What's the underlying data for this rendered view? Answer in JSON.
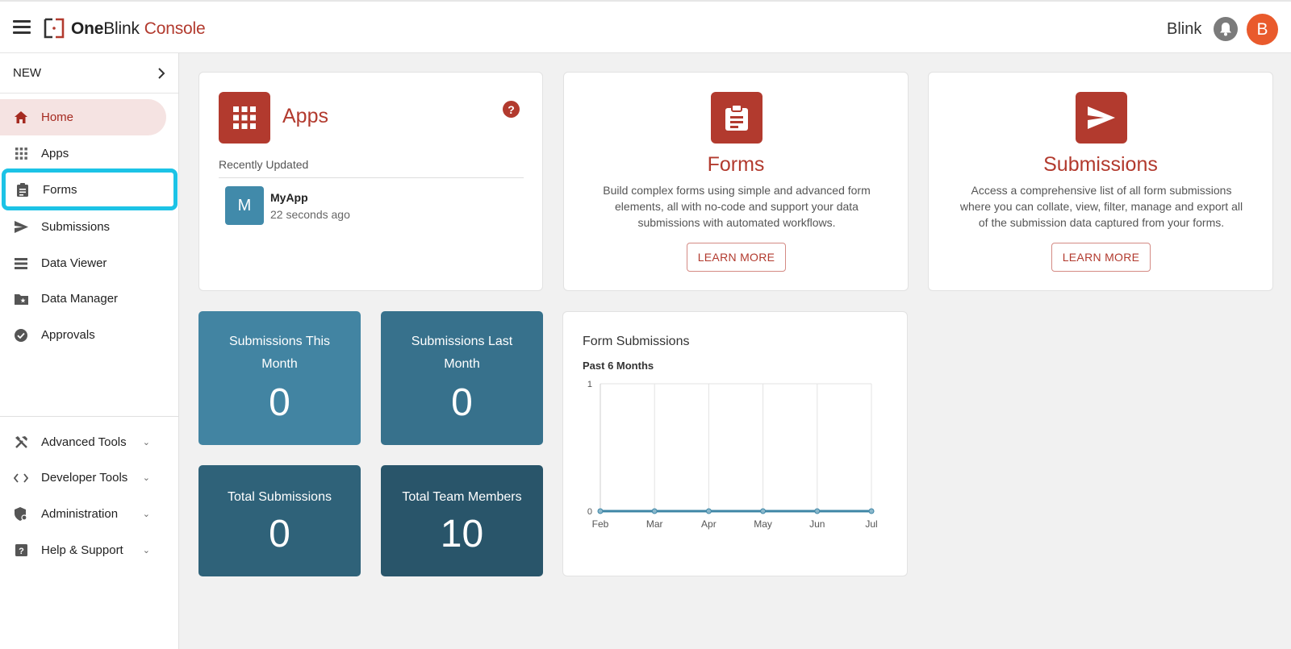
{
  "header": {
    "brand_bold": "One",
    "brand_regular": "Blink",
    "brand_accent": "Console",
    "user_name": "Blink",
    "avatar_initial": "B",
    "icons": [
      "menu-icon",
      "onblink-logo",
      "bell-icon"
    ]
  },
  "sidebar": {
    "new_label": "NEW",
    "items": [
      {
        "label": "Home",
        "icon": "home-icon"
      },
      {
        "label": "Apps",
        "icon": "grid-icon"
      },
      {
        "label": "Forms",
        "icon": "clipboard-icon"
      },
      {
        "label": "Submissions",
        "icon": "send-icon"
      },
      {
        "label": "Data Viewer",
        "icon": "list-icon"
      },
      {
        "label": "Data Manager",
        "icon": "folder-star-icon"
      },
      {
        "label": "Approvals",
        "icon": "check-circle-icon"
      },
      {
        "label": "Advanced Tools",
        "icon": "tools-icon"
      },
      {
        "label": "Developer Tools",
        "icon": "code-icon"
      },
      {
        "label": "Administration",
        "icon": "shield-icon"
      },
      {
        "label": "Help & Support",
        "icon": "help-box-icon"
      }
    ]
  },
  "apps_card": {
    "title": "Apps",
    "recent_label": "Recently Updated",
    "recent_app": {
      "initial": "M",
      "name": "MyApp",
      "updated": "22 seconds ago"
    }
  },
  "forms_card": {
    "title": "Forms",
    "description": "Build complex forms using simple and advanced form elements, all with no-code and support your data submissions with automated workflows.",
    "button": "LEARN MORE"
  },
  "submissions_card": {
    "title": "Submissions",
    "description": "Access a comprehensive list of all form submissions where you can collate, view, filter, manage and export all of the submission data captured from your forms.",
    "button": "LEARN MORE"
  },
  "stats": {
    "this_month": {
      "label": "Submissions This Month",
      "value": "0",
      "color": "#4284a2"
    },
    "last_month": {
      "label": "Submissions Last Month",
      "value": "0",
      "color": "#37718c"
    },
    "total_submissions": {
      "label": "Total Submissions",
      "value": "0",
      "color": "#2f6279"
    },
    "team_members": {
      "label": "Total Team Members",
      "value": "10",
      "color": "#29556a"
    }
  },
  "chart_panel": {
    "title": "Form Submissions",
    "subtitle": "Past 6 Months"
  },
  "chart_data": {
    "type": "line",
    "categories": [
      "Feb",
      "Mar",
      "Apr",
      "May",
      "Jun",
      "Jul"
    ],
    "series": [
      {
        "values": [
          0,
          0,
          0,
          0,
          0,
          0
        ]
      }
    ],
    "ylim": [
      0,
      1
    ],
    "yticks": [
      "0",
      "1"
    ],
    "grid": true,
    "color": "#3e86a6"
  },
  "colors": {
    "brand_red": "#b23a2e",
    "highlight_cyan": "#1cc3e6"
  }
}
